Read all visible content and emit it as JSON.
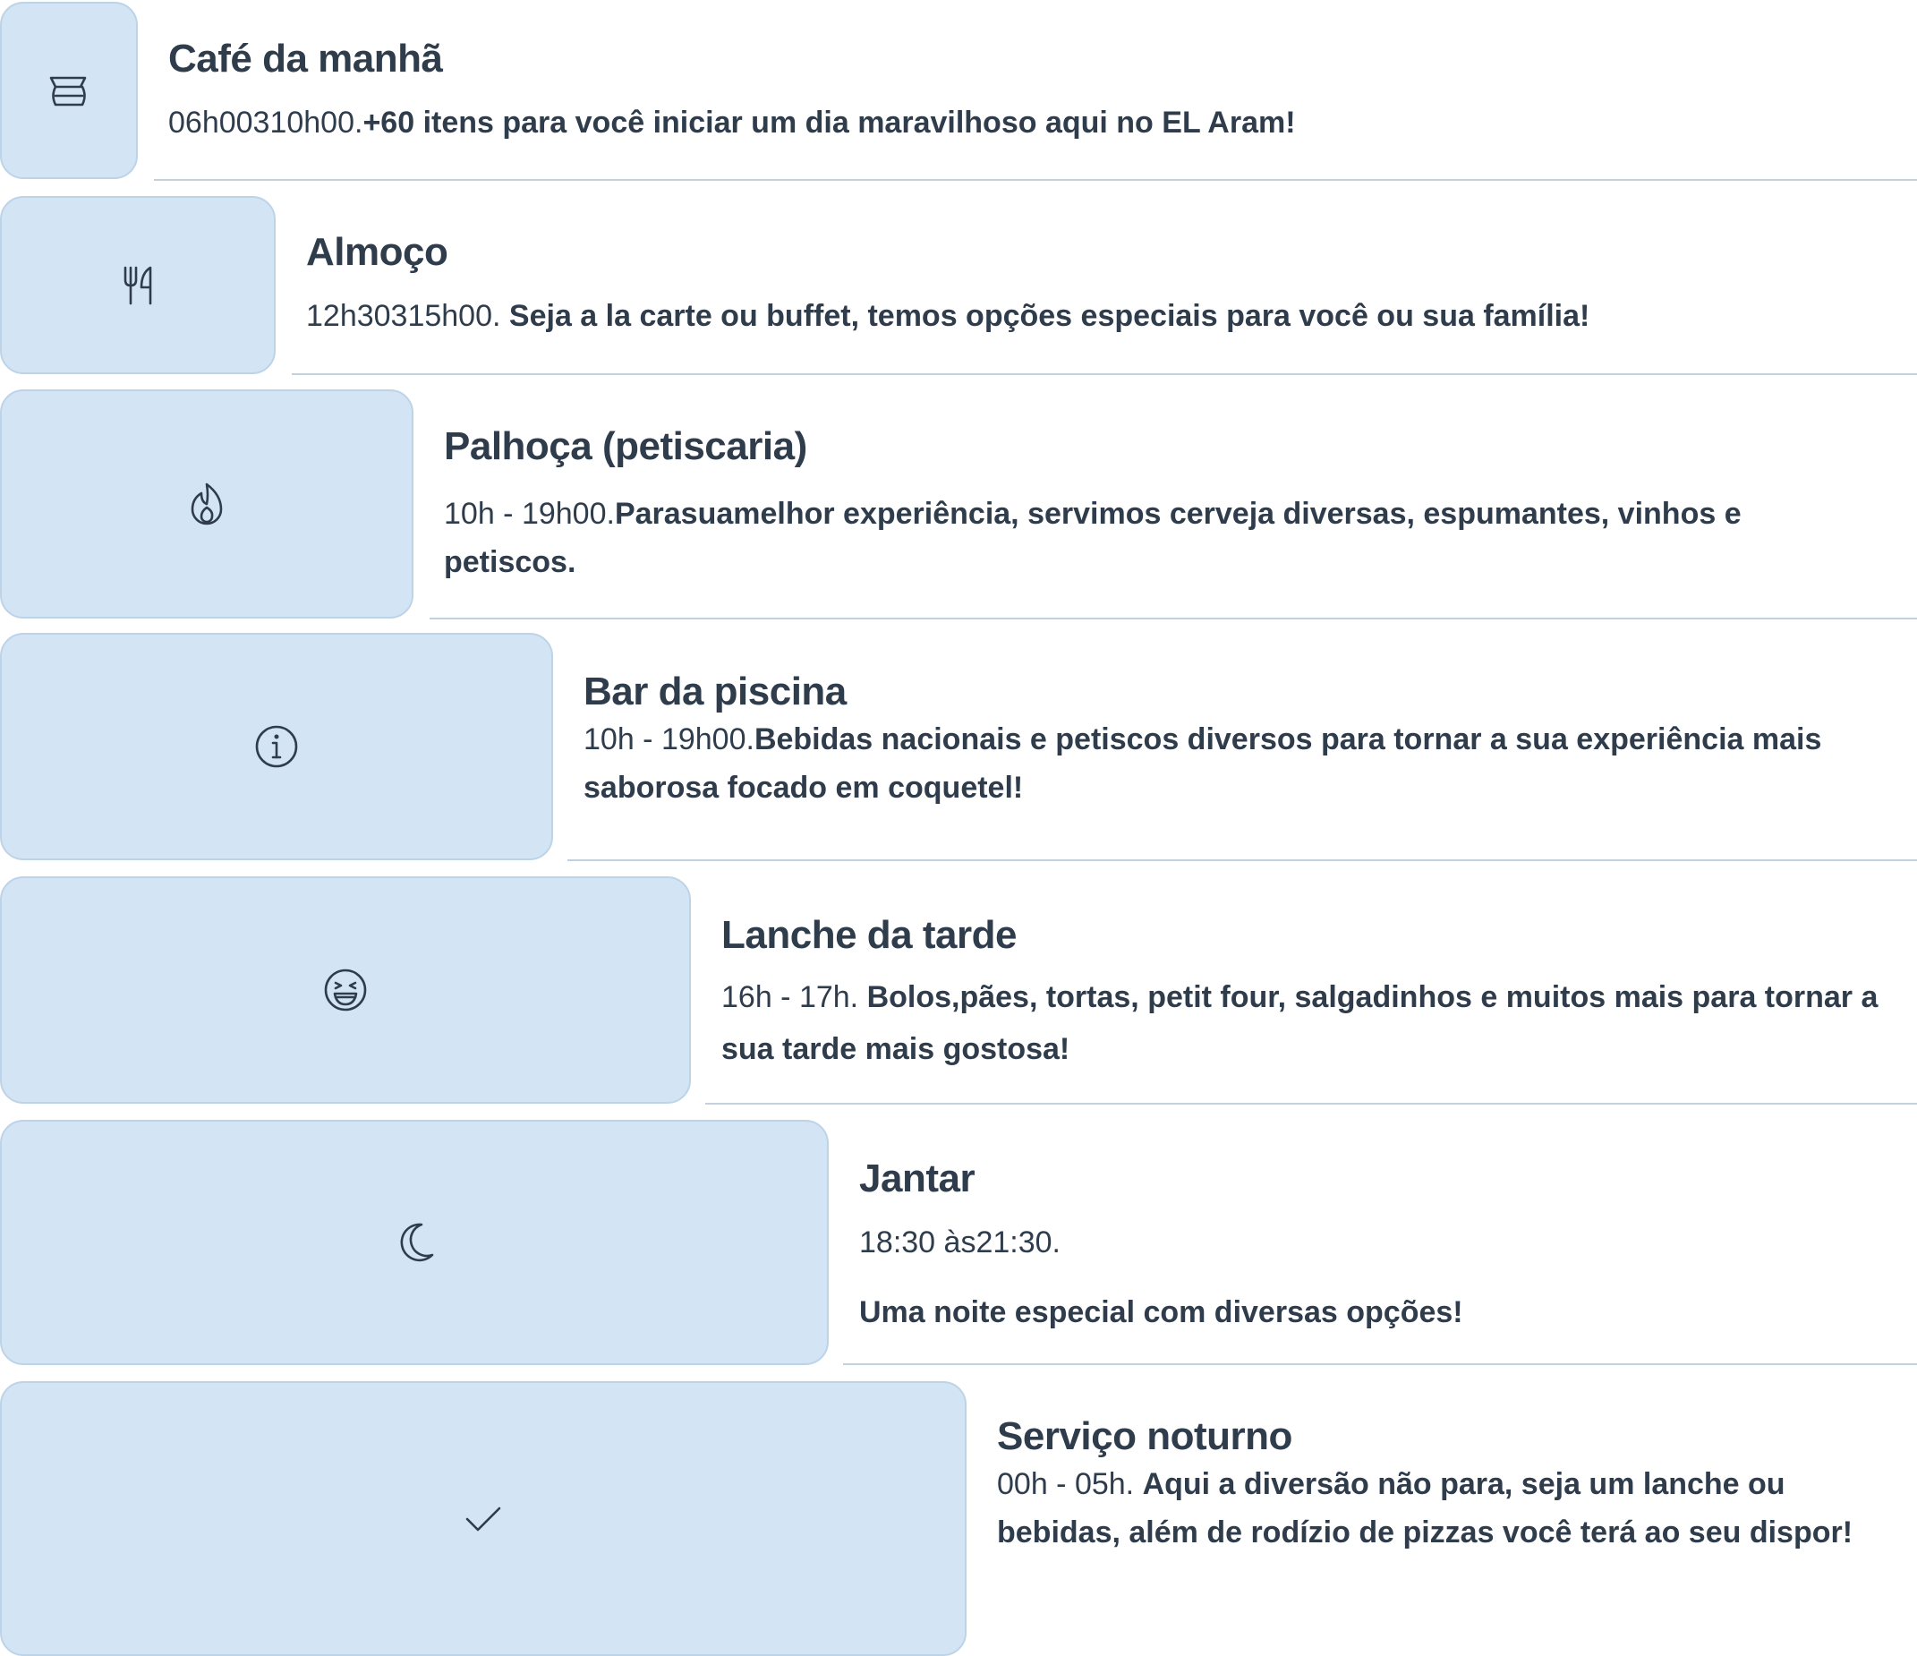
{
  "items": [
    {
      "title": "Café da manhã",
      "hours": "06h00310h00.",
      "text": "+60 itens para você iniciar um dia maravilhoso aqui no EL Aram!",
      "icon": "coffee-pot-icon"
    },
    {
      "title": "Almoço",
      "hours": "12h30315h00. ",
      "text": "Seja a la carte ou buffet, temos opções especiais para você ou sua família!",
      "icon": "fork-knife-icon"
    },
    {
      "title": "Palhoça (petiscaria)",
      "hours": "10h - 19h00.",
      "text": "Parasuamelhor experiência, servimos cerveja diversas, espumantes, vinhos e petiscos.",
      "icon": "flame-icon"
    },
    {
      "title": "Bar da piscina",
      "hours": "10h - 19h00.",
      "text": "Bebidas nacionais e petiscos diversos para tornar a sua experiência mais saborosa focado em coquetel!",
      "icon": "info-icon"
    },
    {
      "title": "Lanche da tarde",
      "hours": "16h - 17h. ",
      "text": "Bolos,pães, tortas, petit four, salgadinhos e muitos mais para tornar a sua tarde mais gostosa!",
      "icon": "laughing-face-icon"
    },
    {
      "title": "Jantar",
      "hours": "18:30 às21:30.",
      "text": "Uma noite especial com diversas opções!",
      "icon": "moon-icon"
    },
    {
      "title": "Serviço noturno",
      "hours": "00h - 05h. ",
      "text": "Aqui a diversão não para, seja um lanche ou bebidas, além de rodízio de pizzas você terá ao seu dispor!",
      "icon": "check-icon"
    }
  ],
  "colors": {
    "icon_box_bg": "#d3e5f4",
    "icon_box_border": "#bdd3e8",
    "text": "#2f3c4c",
    "divider": "#c3d0dd"
  }
}
